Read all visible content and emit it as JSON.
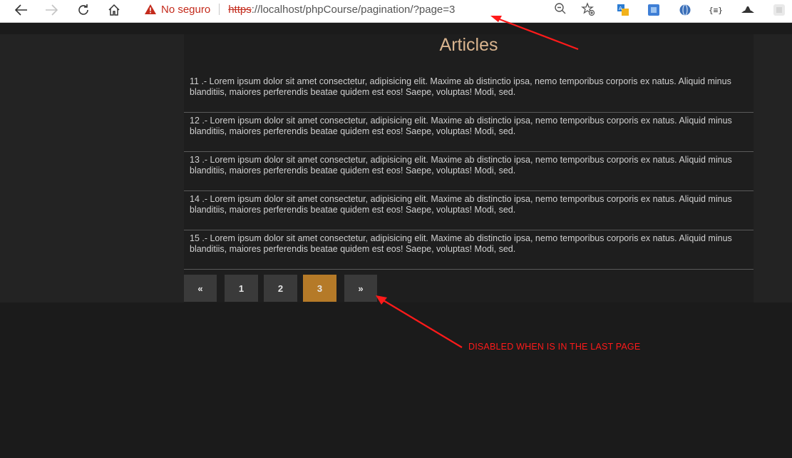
{
  "browser": {
    "security_label": "No seguro",
    "url_protocol": "https",
    "url_rest": "://localhost/phpCourse/pagination/?page=3"
  },
  "page": {
    "title": "Articles",
    "articles": [
      {
        "text": "11 .- Lorem ipsum dolor sit amet consectetur, adipisicing elit. Maxime ab distinctio ipsa, nemo temporibus corporis ex natus. Aliquid minus blanditiis, maiores perferendis beatae quidem est eos! Saepe, voluptas! Modi, sed."
      },
      {
        "text": "12 .- Lorem ipsum dolor sit amet consectetur, adipisicing elit. Maxime ab distinctio ipsa, nemo temporibus corporis ex natus. Aliquid minus blanditiis, maiores perferendis beatae quidem est eos! Saepe, voluptas! Modi, sed."
      },
      {
        "text": "13 .- Lorem ipsum dolor sit amet consectetur, adipisicing elit. Maxime ab distinctio ipsa, nemo temporibus corporis ex natus. Aliquid minus blanditiis, maiores perferendis beatae quidem est eos! Saepe, voluptas! Modi, sed."
      },
      {
        "text": "14 .- Lorem ipsum dolor sit amet consectetur, adipisicing elit. Maxime ab distinctio ipsa, nemo temporibus corporis ex natus. Aliquid minus blanditiis, maiores perferendis beatae quidem est eos! Saepe, voluptas! Modi, sed."
      },
      {
        "text": "15 .- Lorem ipsum dolor sit amet consectetur, adipisicing elit. Maxime ab distinctio ipsa, nemo temporibus corporis ex natus. Aliquid minus blanditiis, maiores perferendis beatae quidem est eos! Saepe, voluptas! Modi, sed."
      }
    ],
    "pagination": {
      "prev": "«",
      "pages": [
        "1",
        "2",
        "3"
      ],
      "current": "3",
      "next": "»"
    }
  },
  "annotation": {
    "text": "DISABLED WHEN IS IN THE LAST PAGE",
    "color": "#ff1a1a"
  },
  "colors": {
    "title": "#d9b48e",
    "active_page": "#b57a28",
    "page_button": "#3a3a3a"
  }
}
